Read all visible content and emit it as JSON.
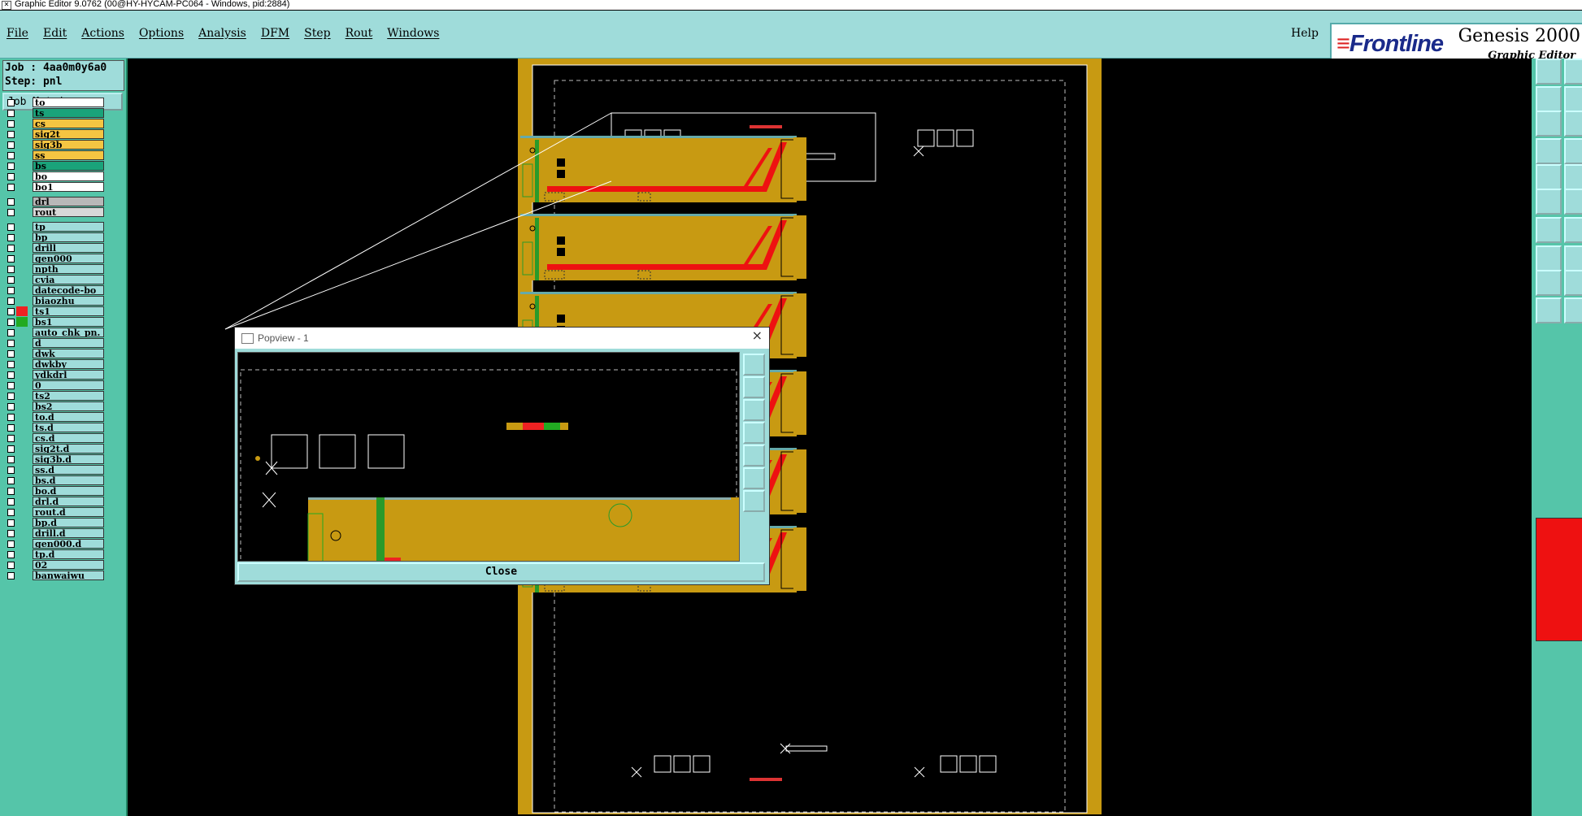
{
  "window": {
    "title": "Graphic Editor 9.0762 (00@HY-HYCAM-PC064 - Windows, pid:2884)"
  },
  "menu": {
    "items": [
      "File",
      "Edit",
      "Actions",
      "Options",
      "Analysis",
      "DFM",
      "Step",
      "Rout",
      "Windows"
    ],
    "help": "Help"
  },
  "logo": {
    "brand": "Frontline",
    "product": "Genesis 2000",
    "subtitle": "Graphic Editor"
  },
  "job": {
    "job_label": "Job : 4aa0m0y6a0",
    "step_label": "Step: pnl",
    "matrix_button": "Job Matrix ..."
  },
  "layers": [
    {
      "name": "to",
      "color": "#ffffff"
    },
    {
      "name": "ts",
      "color": "#1aa37a"
    },
    {
      "name": "cs",
      "color": "#f5c542"
    },
    {
      "name": "sig2t",
      "color": "#f5c542"
    },
    {
      "name": "sig3b",
      "color": "#f5c542"
    },
    {
      "name": "ss",
      "color": "#f5c542"
    },
    {
      "name": "bs",
      "color": "#1aa37a"
    },
    {
      "name": "bo",
      "color": "#ffffff"
    },
    {
      "name": "bo1",
      "color": "#ffffff"
    },
    {
      "name": "drl",
      "color": "#b8b8b8"
    },
    {
      "name": "rout",
      "color": "#d8d8d8"
    },
    {
      "name": "tp",
      "color": "#9fdcda"
    },
    {
      "name": "bp",
      "color": "#9fdcda"
    },
    {
      "name": "drill",
      "color": "#9fdcda"
    },
    {
      "name": "gen000",
      "color": "#9fdcda"
    },
    {
      "name": "npth",
      "color": "#9fdcda"
    },
    {
      "name": "cvia",
      "color": "#9fdcda"
    },
    {
      "name": "datecode-bo",
      "color": "#9fdcda"
    },
    {
      "name": "biaozhu",
      "color": "#9fdcda"
    },
    {
      "name": "ts1",
      "color": "#9fdcda",
      "swatch": "#e22"
    },
    {
      "name": "bs1",
      "color": "#9fdcda",
      "swatch": "#2a2"
    },
    {
      "name": "auto_chk_pn.",
      "color": "#9fdcda"
    },
    {
      "name": "d",
      "color": "#9fdcda"
    },
    {
      "name": "dwk",
      "color": "#9fdcda"
    },
    {
      "name": "dwkby",
      "color": "#9fdcda"
    },
    {
      "name": "ydkdrl",
      "color": "#9fdcda"
    },
    {
      "name": "0",
      "color": "#9fdcda"
    },
    {
      "name": "ts2",
      "color": "#9fdcda"
    },
    {
      "name": "bs2",
      "color": "#9fdcda"
    },
    {
      "name": "to.d",
      "color": "#9fdcda"
    },
    {
      "name": "ts.d",
      "color": "#9fdcda"
    },
    {
      "name": "cs.d",
      "color": "#9fdcda"
    },
    {
      "name": "sig2t.d",
      "color": "#9fdcda"
    },
    {
      "name": "sig3b.d",
      "color": "#9fdcda"
    },
    {
      "name": "ss.d",
      "color": "#9fdcda"
    },
    {
      "name": "bs.d",
      "color": "#9fdcda"
    },
    {
      "name": "bo.d",
      "color": "#9fdcda"
    },
    {
      "name": "drl.d",
      "color": "#9fdcda"
    },
    {
      "name": "rout.d",
      "color": "#9fdcda"
    },
    {
      "name": "bp.d",
      "color": "#9fdcda"
    },
    {
      "name": "drill.d",
      "color": "#9fdcda"
    },
    {
      "name": "gen000.d",
      "color": "#9fdcda"
    },
    {
      "name": "tp.d",
      "color": "#9fdcda"
    },
    {
      "name": "02",
      "color": "#9fdcda"
    },
    {
      "name": "banwaiwu",
      "color": "#9fdcda"
    }
  ],
  "popview": {
    "title": "Popview - 1",
    "close_label": "Close"
  },
  "colors": {
    "board": "#c89a12",
    "copper": "#ee1111",
    "mask": "#2a9a2a",
    "frame": "#ffffff"
  }
}
